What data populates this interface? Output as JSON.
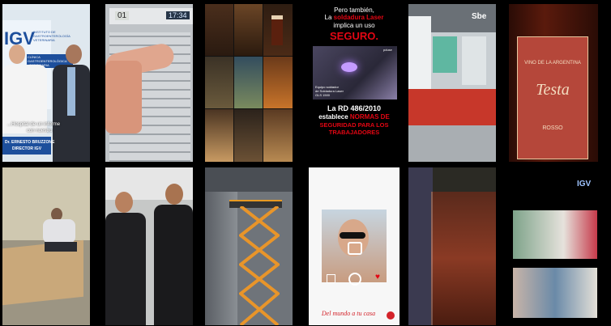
{
  "tiles": {
    "doctors": {
      "logo_text": "IGV",
      "logo_sub1": "INSTITUTO DE",
      "logo_sub2": "GASTROENTEROLOGÍA",
      "logo_sub3": "VETERINARIA",
      "sign_text": "CLÍNICA GASTROENTEROLÓGICA VETERINARIA",
      "caption_line1": "...Hospital de un informe",
      "caption_line2": "con nuestro",
      "name_line1": "Dr. ERNESTO BRUZZONE",
      "name_line2": "DIRECTOR IGV"
    },
    "elevator": {
      "display_left": "01",
      "display_right": "17:34"
    },
    "welding": {
      "line1": "Pero también,",
      "line2a": "La ",
      "line2b": "soldadura Laser",
      "line3": "implica un uso",
      "line4": "SEGURO.",
      "photo_caption_1": "Equipo soldador",
      "photo_caption_2": "de Soldadura Laser",
      "photo_caption_3": "GLS 1500",
      "photo_brand": "pduse",
      "line5": "La RD 486/2010",
      "line6a": "establece ",
      "line6b": "NORMAS DE",
      "line7": "SEGURIDAD PARA LOS",
      "line8": "TRABAJADORES"
    },
    "expo": {
      "logo_text": "Sbe"
    },
    "wine": {
      "label_top": "VINO DE LA ARGENTINA",
      "label_brand": "Testa",
      "label_bottom": "ROSSO"
    },
    "phone_app": {
      "footer_text": "Del mundo a tu casa"
    },
    "clinic": {
      "logo_text": "IGV"
    }
  },
  "colors": {
    "background": "#000000",
    "welding_red": "#e30613",
    "igv_blue": "#1d4f9c"
  },
  "icons": [
    "play-icon",
    "camera-icon",
    "heart-icon",
    "gallery-icon"
  ]
}
